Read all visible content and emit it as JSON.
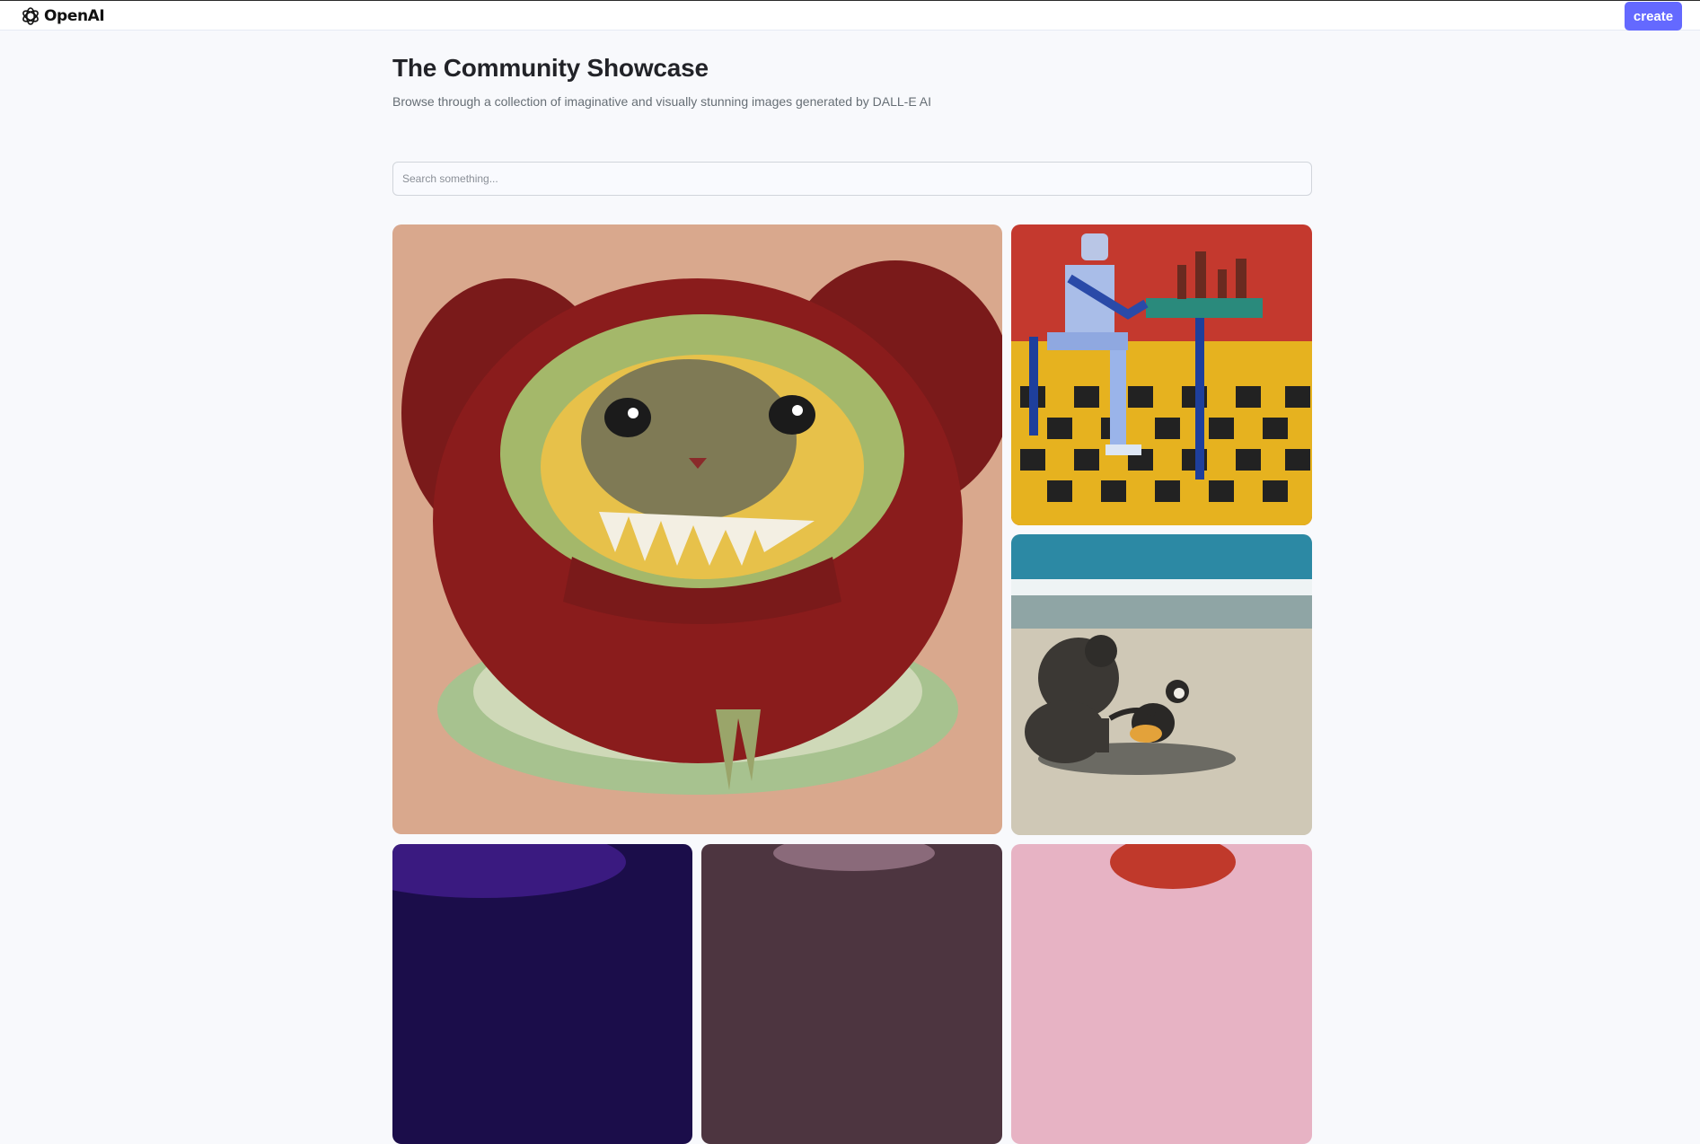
{
  "header": {
    "brand": "OpenAI",
    "create_label": "create"
  },
  "hero": {
    "title": "The Community Showcase",
    "subtitle": "Browse through a collection of imaginative and visually stunning images generated by DALL-E AI"
  },
  "search": {
    "placeholder": "Search something...",
    "value": ""
  },
  "colors": {
    "accent": "#6469ff",
    "page_background": "#f8f9fc",
    "title_text": "#222328",
    "subtitle_text": "#666e75"
  },
  "icons": {
    "logo": "openai-logo-icon"
  }
}
